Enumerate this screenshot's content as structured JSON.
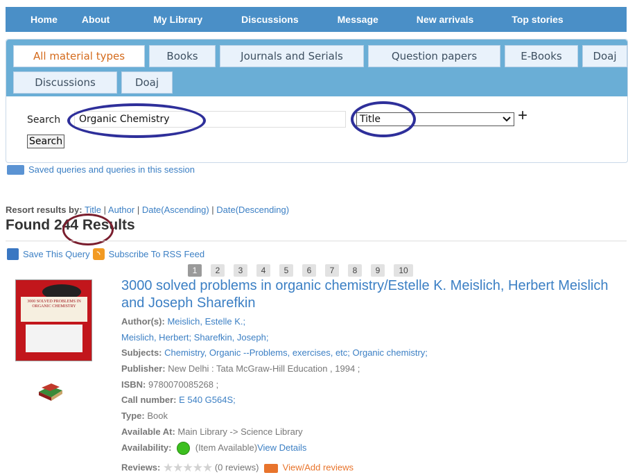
{
  "nav": {
    "items": [
      "Home",
      "About",
      "My Library",
      "Discussions",
      "Message",
      "New arrivals",
      "Top stories"
    ]
  },
  "tabs": [
    "All material types",
    "Books",
    "Journals and Serials",
    "Question papers",
    "E-Books",
    "Doaj",
    "Discussions",
    "Doaj"
  ],
  "search": {
    "label": "Search",
    "query": "Organic Chemistry",
    "field": "Title",
    "button": "Search",
    "add": "+"
  },
  "saved_queries": "Saved queries and queries in this session",
  "resort": {
    "label": "Resort results by:",
    "options": [
      "Title",
      "Author",
      "Date(Ascending)",
      "Date(Descending)"
    ]
  },
  "found": {
    "prefix": "Found",
    "count": "244",
    "suffix": "Results"
  },
  "actions": {
    "save": "Save This Query",
    "subscribe": "Subscribe To RSS Feed"
  },
  "pagination": [
    "1",
    "2",
    "3",
    "4",
    "5",
    "6",
    "7",
    "8",
    "9",
    "10"
  ],
  "result": {
    "title": "3000 solved problems in organic chemistry/Estelle K. Meislich, Herbert Meislich and Joseph Sharefkin",
    "cover_text": "3000 SOLVED PROBLEMS IN ORGANIC CHEMISTRY",
    "authors_label": "Author(s):",
    "authors_line1": "Meislich, Estelle K.;",
    "authors_line2": "Meislich, Herbert; Sharefkin, Joseph;",
    "subjects_label": "Subjects:",
    "subjects": "Chemistry, Organic --Problems, exercises, etc; Organic chemistry;",
    "publisher_label": "Publisher:",
    "publisher": "New Delhi : Tata McGraw-Hill Education , 1994 ;",
    "isbn_label": "ISBN:",
    "isbn": "9780070085268 ;",
    "call_label": "Call number:",
    "call": "E 540 G564S;",
    "type_label": "Type:",
    "type": "Book",
    "available_label": "Available At:",
    "available": "Main Library -> Science Library",
    "availability_label": "Availability:",
    "availability": "(Item Available)",
    "view_details": "View Details",
    "reviews_label": "Reviews:",
    "stars": "★★★★★",
    "reviews_count": "(0 reviews)",
    "view_add_reviews": "View/Add reviews"
  },
  "colors": {
    "nav_bg": "#4a8fc7",
    "tab_bar": "#6aaed6",
    "active_tab_text": "#d46a1b",
    "link": "#3b7fc4",
    "annotation_blue": "#2e2f9a",
    "annotation_red": "#7a1e2e",
    "available_green": "#3cbf1f"
  }
}
